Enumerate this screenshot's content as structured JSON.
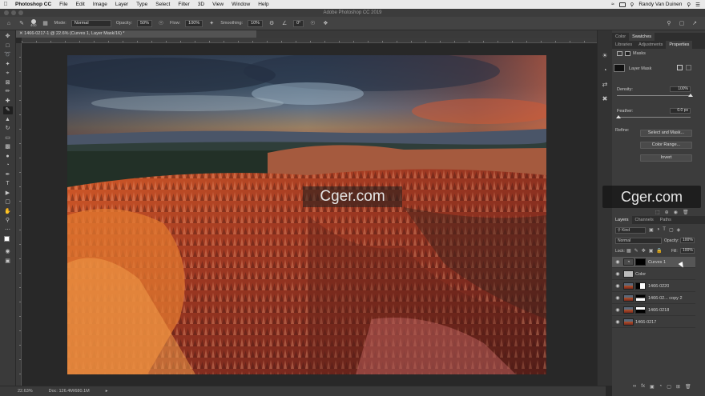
{
  "menubar": {
    "app": "Photoshop CC",
    "items": [
      "File",
      "Edit",
      "Image",
      "Layer",
      "Type",
      "Select",
      "Filter",
      "3D",
      "View",
      "Window",
      "Help"
    ],
    "user": "Randy Van Duinen"
  },
  "titlebar": {
    "title": "Adobe Photoshop CC 2019"
  },
  "options": {
    "brush_size": "400",
    "mode_label": "Mode:",
    "mode_value": "Normal",
    "opacity_label": "Opacity:",
    "opacity_value": "50%",
    "flow_label": "Flow:",
    "flow_value": "100%",
    "smoothing_label": "Smoothing:",
    "smoothing_value": "10%",
    "angle_value": "0°"
  },
  "document": {
    "tab_title": "1466-0217-1 @ 22.6% (Curves 1, Layer Mask/16) *"
  },
  "status": {
    "zoom": "22.63%",
    "doc": "Doc: 126.4M/680.1M"
  },
  "panels": {
    "top_tabs": [
      "Color",
      "Swatches"
    ],
    "second_tabs": [
      "Libraries",
      "Adjustments",
      "Properties"
    ],
    "properties": {
      "masks_label": "Masks",
      "layer_mask_label": "Layer Mask",
      "density_label": "Density:",
      "density_value": "100%",
      "feather_label": "Feather:",
      "feather_value": "0.0 px",
      "density_fraction": 1.0,
      "feather_fraction": 0.0,
      "refine_label": "Refine:",
      "select_and_mask": "Select and Mask...",
      "color_range": "Color Range...",
      "invert": "Invert"
    },
    "layers_tabs": [
      "Layers",
      "Channels",
      "Paths"
    ],
    "layers": {
      "filter_kind": "Kind",
      "blend_mode": "Normal",
      "opacity_label": "Opacity:",
      "opacity_value": "100%",
      "lock_label": "Lock:",
      "fill_label": "Fill:",
      "fill_value": "100%",
      "items": [
        {
          "name": "Curves 1",
          "type": "adjustment",
          "selected": true
        },
        {
          "name": "Color",
          "type": "fill",
          "selected": false
        },
        {
          "name": "1466-0220",
          "type": "image",
          "selected": false
        },
        {
          "name": "1466-02... copy 2",
          "type": "image",
          "selected": false
        },
        {
          "name": "1466-0218",
          "type": "image",
          "selected": false
        },
        {
          "name": "1466-0217",
          "type": "image",
          "selected": false
        }
      ]
    }
  },
  "watermark": "Cger.com",
  "watermark2": "Cger.com",
  "colors": {
    "menubar_bg": "#e9e9e9",
    "ui_dark": "#282828",
    "panel_bg": "#3c3c3c",
    "selected_layer": "#565656"
  }
}
